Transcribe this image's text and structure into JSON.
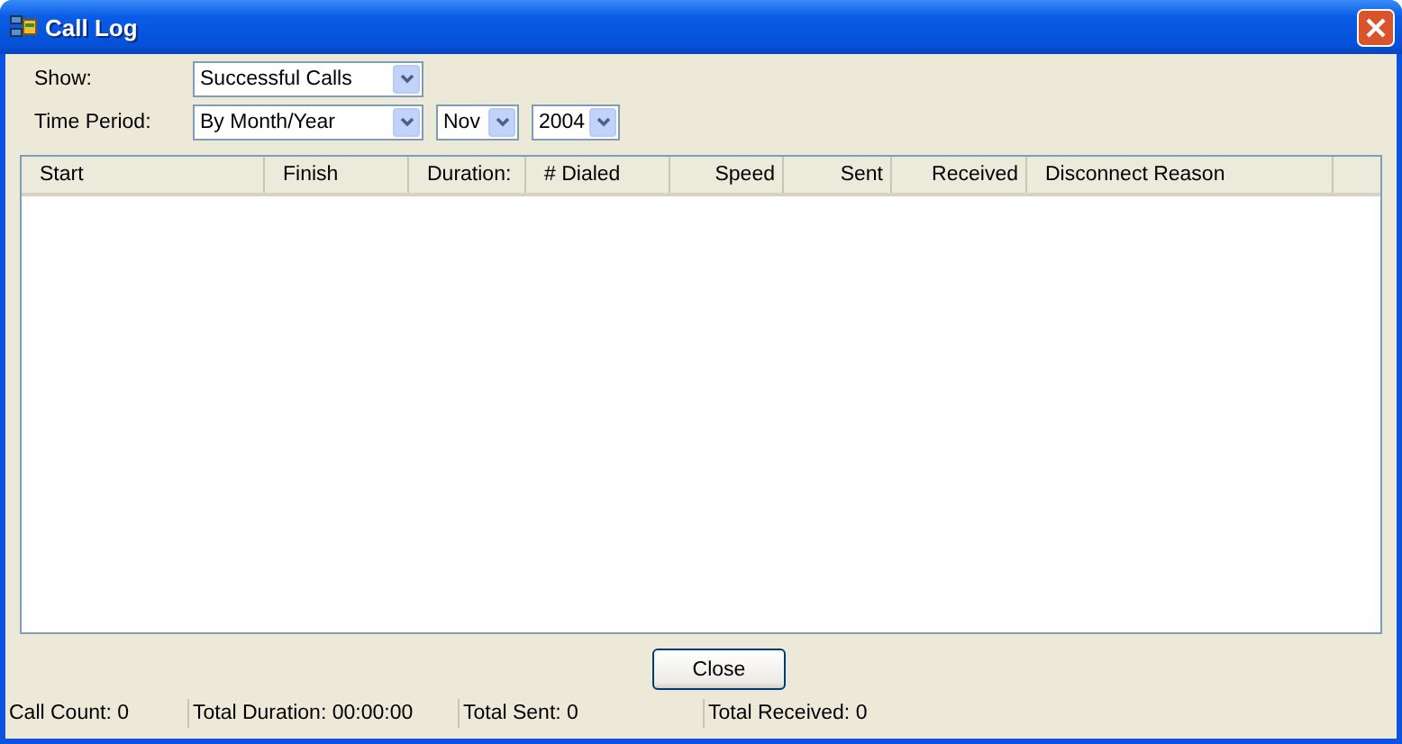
{
  "window": {
    "title": "Call Log"
  },
  "filters": [
    {
      "label": "Show:",
      "selects": [
        "Successful Calls"
      ]
    },
    {
      "label": "Time Period:",
      "selects": [
        "By Month/Year",
        "Nov",
        "2004"
      ]
    }
  ],
  "table": {
    "columns": [
      "Start",
      "Finish",
      "Duration:",
      "# Dialed",
      "Speed",
      "Sent",
      "Received",
      "Disconnect Reason"
    ]
  },
  "buttons": [
    "Close"
  ],
  "status_bar": [
    "Call Count: 0",
    "Total Duration: 00:00:00",
    "Total Sent: 0",
    "Total Received: 0"
  ]
}
